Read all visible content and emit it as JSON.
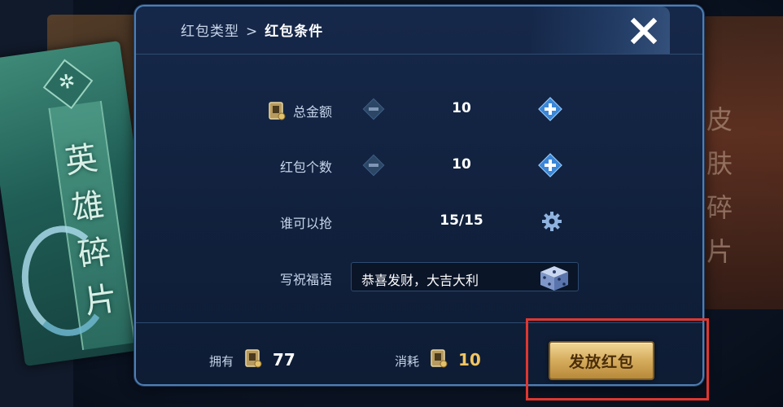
{
  "background": {
    "left_card_title": "英雄碎片",
    "right_card_title": "皮肤碎片"
  },
  "dialog": {
    "breadcrumb": {
      "parent": "红包类型",
      "separator": ">",
      "current": "红包条件"
    },
    "close_icon": "close-icon"
  },
  "form": {
    "total_amount": {
      "label": "总金额",
      "value": "10",
      "icon": "coin-icon"
    },
    "count": {
      "label": "红包个数",
      "value": "10"
    },
    "who_can_grab": {
      "label": "谁可以抢",
      "value": "15/15",
      "icon": "gear-icon"
    },
    "blessing": {
      "label": "写祝福语",
      "value": "恭喜发财，大吉大利",
      "icon": "dice-icon"
    }
  },
  "footer": {
    "own_label": "拥有",
    "own_value": "77",
    "cost_label": "消耗",
    "cost_value": "10",
    "send_button": "发放红包"
  },
  "colors": {
    "accent_gold": "#f3c561",
    "highlight_red": "#e0362f",
    "panel_border": "#4e7fb3"
  }
}
